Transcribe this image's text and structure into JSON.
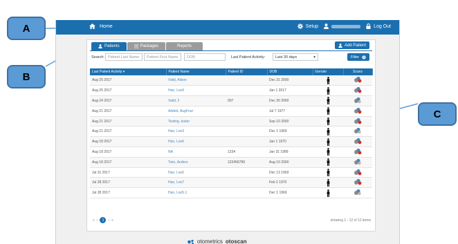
{
  "callouts": {
    "a": "A",
    "b": "B",
    "c": "C"
  },
  "topbar": {
    "home_label": "Home",
    "setup_label": "Setup",
    "logout_label": "Log Out"
  },
  "tabs": [
    {
      "label": "Patients"
    },
    {
      "label": "Packages"
    },
    {
      "label": "Reports"
    }
  ],
  "add_patient_label": "Add Patient",
  "search": {
    "label": "Search:",
    "last_name_placeholder": "Patient Last Name",
    "first_name_placeholder": "Patient First Name",
    "dob_placeholder": "DOB",
    "activity_label": "Last Patient Activity:",
    "activity_value": "Last 30 days",
    "filter_label": "Filter"
  },
  "table": {
    "headers": [
      "Last Patient Activity",
      "Patient Name",
      "Patient ID",
      "DOB",
      "Gender",
      "Scans"
    ],
    "rows": [
      {
        "activity": "Aug 25 2017",
        "name": "Valid, Alison",
        "id": "",
        "dob": "Dec 31 2000"
      },
      {
        "activity": "Aug 25 2017",
        "name": "Han, Loo9",
        "id": "",
        "dob": "Jan 1 2017"
      },
      {
        "activity": "Aug 24 2017",
        "name": "Valid, 2",
        "id": "007",
        "dob": "Dec 30 2000"
      },
      {
        "activity": "Aug 21 2017",
        "name": "Added, AugFour",
        "id": "",
        "dob": "Jul 7 1977"
      },
      {
        "activity": "Aug 21 2017",
        "name": "Testing, tester",
        "id": "",
        "dob": "Sep 10 2000"
      },
      {
        "activity": "Aug 21 2017",
        "name": "Han, Loo3",
        "id": "",
        "dob": "Dec 1 1969"
      },
      {
        "activity": "Aug 18 2017",
        "name": "Han, Loo6",
        "id": "",
        "dob": "Jan 1 1970"
      },
      {
        "activity": "Aug 18 2017",
        "name": "NA",
        "id": "1234",
        "dob": "Jan 31 1989"
      },
      {
        "activity": "Aug 18 2017",
        "name": "Twin, Anders",
        "id": "123456789",
        "dob": "Aug 10 2000"
      },
      {
        "activity": "Jul 31 2017",
        "name": "Han, Loo5",
        "id": "",
        "dob": "Dec 13 1969"
      },
      {
        "activity": "Jul 28 2017",
        "name": "Han, Loo7",
        "id": "",
        "dob": "Feb 2 1970"
      },
      {
        "activity": "Jul 28 2017",
        "name": "Han, Loo5.1",
        "id": "",
        "dob": "Dec 1 1969"
      }
    ]
  },
  "pager": {
    "current_page": "1"
  },
  "showing_text": "showing 1 - 12 of 12 items",
  "brand": {
    "part1": "otometrics",
    "part2": "otoscan"
  },
  "colors": {
    "primary": "#1b6faf",
    "callout": "#5b9bd5",
    "link": "#4a86bd"
  }
}
